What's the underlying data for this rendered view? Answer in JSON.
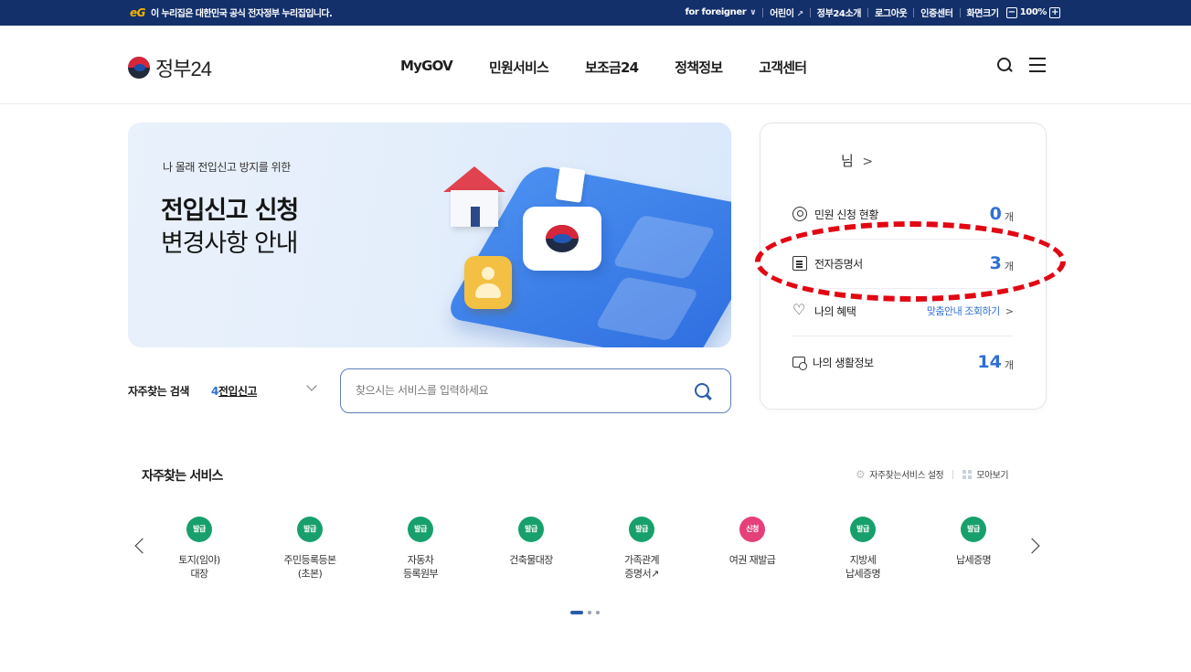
{
  "topbar": {
    "eg_logo": "eG",
    "brand_text": "이 누리집은 대한민국 공식 전자정부 누리집입니다.",
    "foreigner": "for foreigner",
    "kids": "어린이",
    "intro": "정부24소개",
    "logout": "로그아웃",
    "cert_center": "인증센터",
    "screen_size": "화면크기",
    "zoom_minus": "−",
    "zoom": "100%",
    "zoom_plus": "+"
  },
  "header": {
    "logo_text": "정부24",
    "nav": [
      "MyGOV",
      "민원서비스",
      "보조금24",
      "정책정보",
      "고객센터"
    ]
  },
  "banner": {
    "subtitle": "나 몰래 전입신고 방지를 위한",
    "title_line1": "전입신고 신청",
    "title_line2": "변경사항 안내"
  },
  "user_panel": {
    "greeting": "님",
    "rows": [
      {
        "label": "민원 신청 현황",
        "value": "0",
        "unit": "개"
      },
      {
        "label": "전자증명서",
        "value": "3",
        "unit": "개"
      },
      {
        "label": "나의 혜택",
        "link": "맞춤안내 조회하기"
      },
      {
        "label": "나의 생활정보",
        "value": "14",
        "unit": "개"
      }
    ],
    "highlight_color": "#e30613"
  },
  "search": {
    "label": "자주찾는 검색",
    "keyword_rank": "4",
    "keyword": "전입신고",
    "placeholder": "찾으시는 서비스를 입력하세요"
  },
  "services": {
    "title": "자주찾는 서비스",
    "settings": "자주찾는서비스 설정",
    "view_all": "모아보기",
    "items": [
      {
        "badge": "발급",
        "line1": "토지(임야)",
        "line2": "대장"
      },
      {
        "badge": "발급",
        "line1": "주민등록등본",
        "line2": "(초본)"
      },
      {
        "badge": "발급",
        "line1": "자동차",
        "line2": "등록원부"
      },
      {
        "badge": "발급",
        "line1": "건축물대장",
        "line2": ""
      },
      {
        "badge": "발급",
        "line1": "가족관계",
        "line2": "증명서↗"
      },
      {
        "badge": "신청",
        "line1": "여권 재발급",
        "line2": ""
      },
      {
        "badge": "발급",
        "line1": "지방세",
        "line2": "납세증명"
      },
      {
        "badge": "발급",
        "line1": "납세증명",
        "line2": ""
      }
    ],
    "badge_colors": {
      "issue": "#17a06b",
      "apply": "#e5407a"
    }
  }
}
